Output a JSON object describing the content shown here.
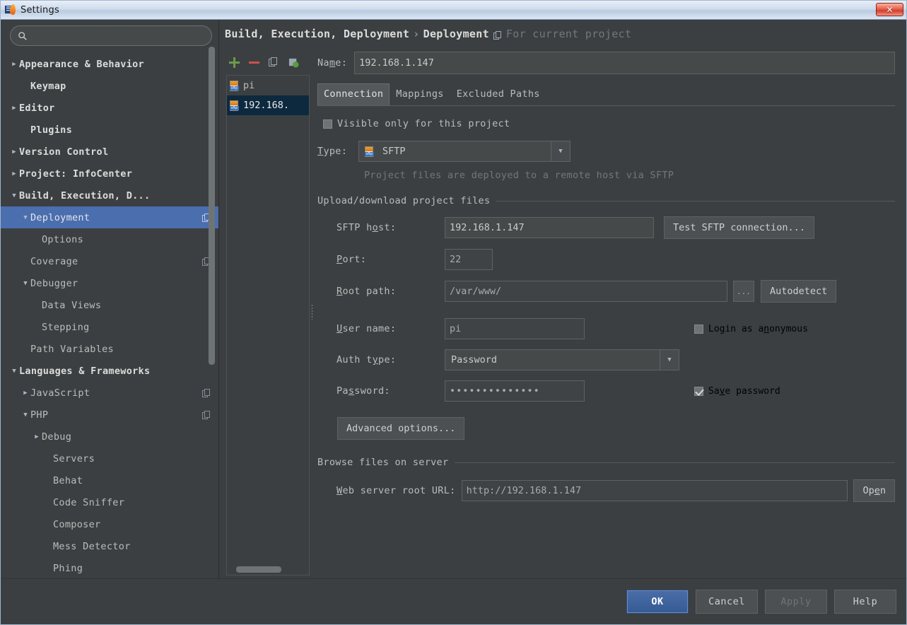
{
  "window": {
    "title": "Settings",
    "close_label": "✕"
  },
  "search": {
    "value": "",
    "placeholder": ""
  },
  "sidebar": {
    "items": [
      {
        "label": "Appearance & Behavior",
        "arrow": "right",
        "indent": 0,
        "bold": true,
        "badge": false,
        "selected": false
      },
      {
        "label": "Keymap",
        "arrow": "none",
        "indent": 1,
        "bold": true,
        "badge": false,
        "selected": false
      },
      {
        "label": "Editor",
        "arrow": "right",
        "indent": 0,
        "bold": true,
        "badge": false,
        "selected": false
      },
      {
        "label": "Plugins",
        "arrow": "none",
        "indent": 1,
        "bold": true,
        "badge": false,
        "selected": false
      },
      {
        "label": "Version Control",
        "arrow": "right",
        "indent": 0,
        "bold": true,
        "badge": false,
        "selected": false
      },
      {
        "label": "Project: InfoCenter",
        "arrow": "right",
        "indent": 0,
        "bold": true,
        "badge": false,
        "selected": false
      },
      {
        "label": "Build, Execution, D...",
        "arrow": "down",
        "indent": 0,
        "bold": true,
        "badge": false,
        "selected": false
      },
      {
        "label": "Deployment",
        "arrow": "down",
        "indent": 1,
        "bold": false,
        "badge": true,
        "selected": true
      },
      {
        "label": "Options",
        "arrow": "none",
        "indent": 2,
        "bold": false,
        "badge": false,
        "selected": false
      },
      {
        "label": "Coverage",
        "arrow": "none",
        "indent": 1,
        "bold": false,
        "badge": true,
        "selected": false
      },
      {
        "label": "Debugger",
        "arrow": "down",
        "indent": 1,
        "bold": false,
        "badge": false,
        "selected": false
      },
      {
        "label": "Data Views",
        "arrow": "none",
        "indent": 2,
        "bold": false,
        "badge": false,
        "selected": false
      },
      {
        "label": "Stepping",
        "arrow": "none",
        "indent": 2,
        "bold": false,
        "badge": false,
        "selected": false
      },
      {
        "label": "Path Variables",
        "arrow": "none",
        "indent": 1,
        "bold": false,
        "badge": false,
        "selected": false
      },
      {
        "label": "Languages & Frameworks",
        "arrow": "down",
        "indent": 0,
        "bold": true,
        "badge": false,
        "selected": false
      },
      {
        "label": "JavaScript",
        "arrow": "right",
        "indent": 1,
        "bold": false,
        "badge": true,
        "selected": false
      },
      {
        "label": "PHP",
        "arrow": "down",
        "indent": 1,
        "bold": false,
        "badge": true,
        "selected": false
      },
      {
        "label": "Debug",
        "arrow": "right",
        "indent": 2,
        "bold": false,
        "badge": false,
        "selected": false
      },
      {
        "label": "Servers",
        "arrow": "none",
        "indent": 3,
        "bold": false,
        "badge": false,
        "selected": false
      },
      {
        "label": "Behat",
        "arrow": "none",
        "indent": 3,
        "bold": false,
        "badge": false,
        "selected": false
      },
      {
        "label": "Code Sniffer",
        "arrow": "none",
        "indent": 3,
        "bold": false,
        "badge": false,
        "selected": false
      },
      {
        "label": "Composer",
        "arrow": "none",
        "indent": 3,
        "bold": false,
        "badge": false,
        "selected": false
      },
      {
        "label": "Mess Detector",
        "arrow": "none",
        "indent": 3,
        "bold": false,
        "badge": false,
        "selected": false
      },
      {
        "label": "Phing",
        "arrow": "none",
        "indent": 3,
        "bold": false,
        "badge": false,
        "selected": false
      }
    ]
  },
  "breadcrumb": {
    "root": "Build, Execution, Deployment",
    "separator": "›",
    "leaf": "Deployment",
    "scope_note": "For current project"
  },
  "server_toolbar": {
    "add_label": "+",
    "remove_label": "−",
    "copy_label": "copy-icon",
    "toggle_label": "set-default-icon"
  },
  "server_list": {
    "items": [
      {
        "label": "192.168.",
        "selected": true
      },
      {
        "label": "pi",
        "selected": false
      }
    ]
  },
  "form": {
    "name_label": "Name:",
    "name_value": "192.168.1.147",
    "tabs": [
      {
        "label": "Connection",
        "active": true
      },
      {
        "label": "Mappings",
        "active": false
      },
      {
        "label": "Excluded Paths",
        "active": false
      }
    ],
    "visible_only_label": "Visible only for this project",
    "visible_only_checked": false,
    "type_label": "Type:",
    "type_value": "SFTP",
    "type_hint": "Project files are deployed to a remote host via SFTP",
    "upload_group": "Upload/download project files",
    "host_label": "SFTP host:",
    "host_value": "192.168.1.147",
    "test_button": "Test SFTP connection...",
    "port_label": "Port:",
    "port_value": "22",
    "root_label": "Root path:",
    "root_value": "/var/www/",
    "browse_button": "...",
    "autodetect_button": "Autodetect",
    "user_label": "User name:",
    "user_value": "pi",
    "anonymous_label": "Login as anonymous",
    "anonymous_checked": false,
    "auth_label": "Auth type:",
    "auth_value": "Password",
    "password_label": "Password:",
    "password_value": "••••••••••••••",
    "save_password_label": "Save password",
    "save_password_checked": true,
    "advanced_button": "Advanced options...",
    "browse_group": "Browse files on server",
    "weburl_label": "Web server root URL:",
    "weburl_value": "http://192.168.1.147",
    "open_button": "Open"
  },
  "footer": {
    "ok": "OK",
    "cancel": "Cancel",
    "apply": "Apply",
    "help": "Help"
  },
  "colors": {
    "accent": "#4b6eaf",
    "panel": "#3c3f41",
    "field": "#45494a",
    "text": "#bbbbbb",
    "add": "#6a9b4b",
    "remove": "#c75450"
  }
}
